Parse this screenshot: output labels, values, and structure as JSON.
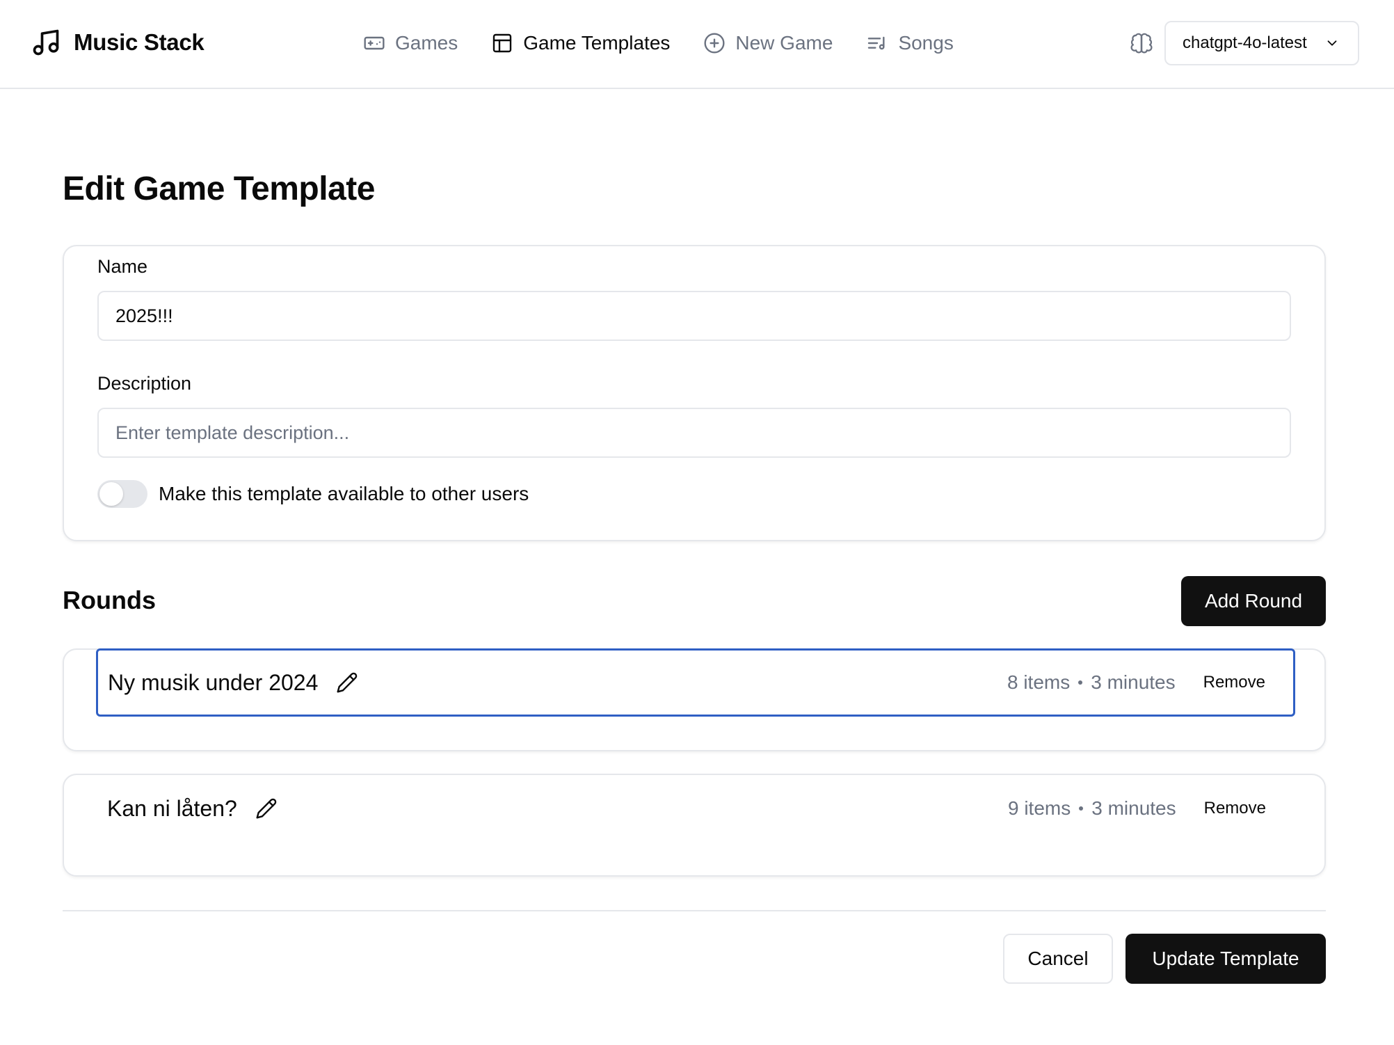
{
  "brand": {
    "name": "Music Stack",
    "icon": "music-note-icon"
  },
  "nav": {
    "items": [
      {
        "label": "Games",
        "icon": "gamepad-icon",
        "active": false
      },
      {
        "label": "Game Templates",
        "icon": "template-icon",
        "active": true
      },
      {
        "label": "New Game",
        "icon": "plus-circle-icon",
        "active": false
      },
      {
        "label": "Songs",
        "icon": "playlist-icon",
        "active": false
      }
    ]
  },
  "model_selector": {
    "value": "chatgpt-4o-latest",
    "icon": "brain-icon"
  },
  "page": {
    "title": "Edit Game Template"
  },
  "form": {
    "name_label": "Name",
    "name_value": "2025!!!",
    "description_label": "Description",
    "description_value": "",
    "description_placeholder": "Enter template description...",
    "public_toggle_label": "Make this template available to other users",
    "public_toggle_on": false
  },
  "rounds": {
    "title": "Rounds",
    "add_label": "Add Round",
    "items": [
      {
        "name": "Ny musik under 2024",
        "items": "8 items",
        "duration": "3 minutes",
        "remove_label": "Remove",
        "focused": true
      },
      {
        "name": "Kan ni låten?",
        "items": "9 items",
        "duration": "3 minutes",
        "remove_label": "Remove",
        "focused": false
      }
    ]
  },
  "actions": {
    "cancel_label": "Cancel",
    "update_label": "Update Template"
  },
  "colors": {
    "primary": "#111111",
    "muted": "#6b7280",
    "border": "#e5e7eb",
    "focus_ring": "#2f5fc4"
  }
}
